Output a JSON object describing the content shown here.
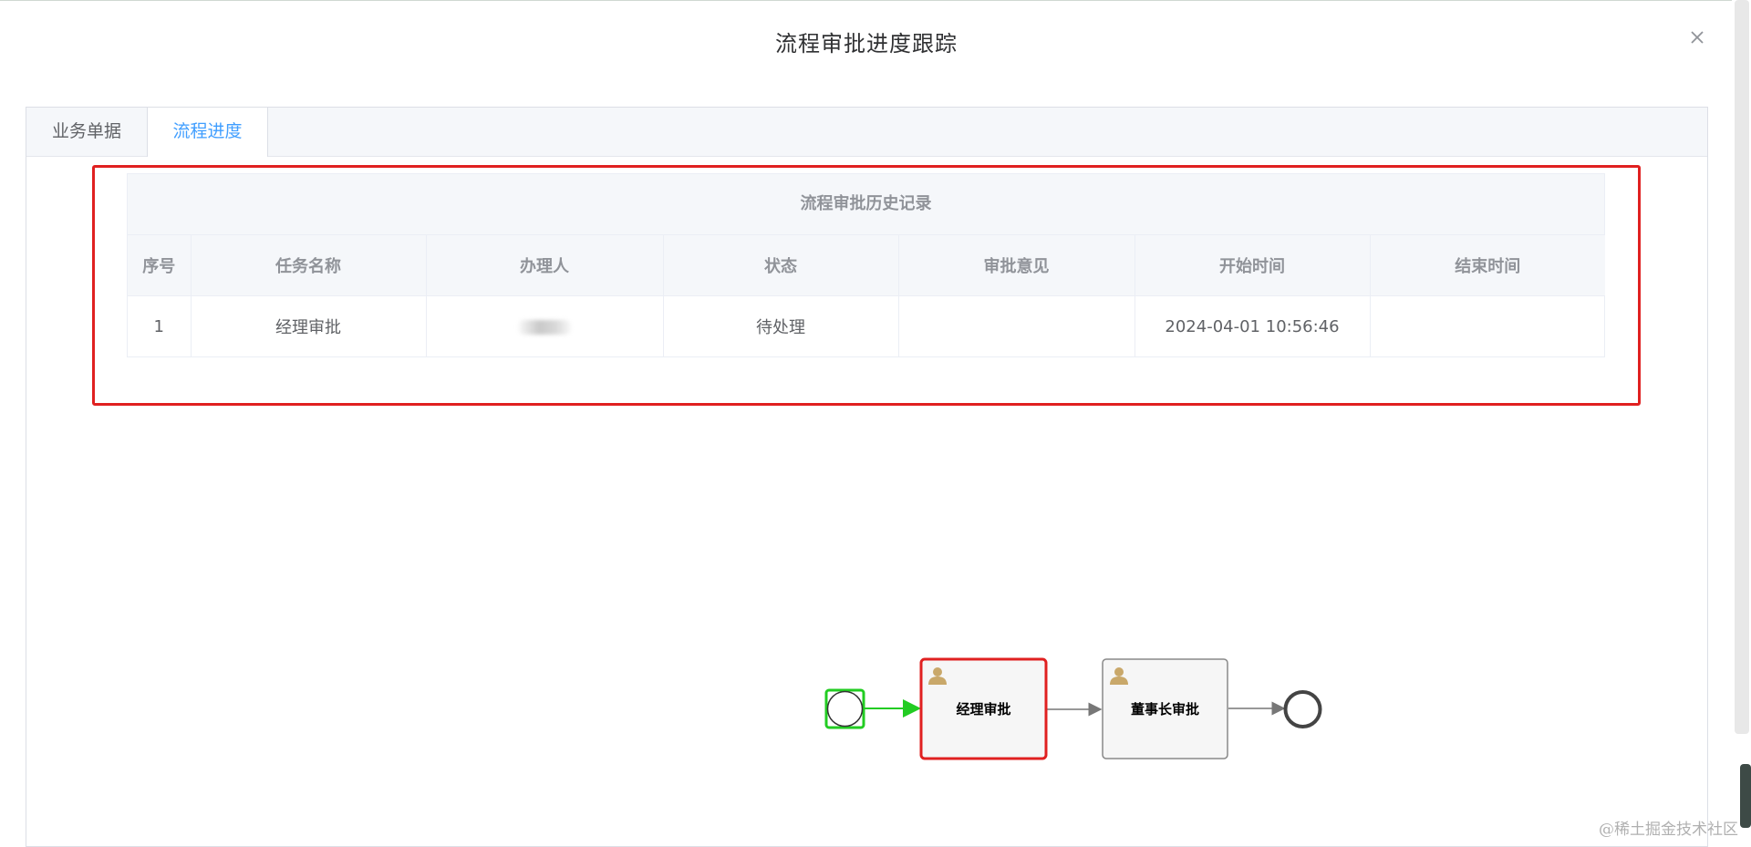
{
  "dialog": {
    "title": "流程审批进度跟踪"
  },
  "tabs": [
    {
      "label": "业务单据",
      "active": false
    },
    {
      "label": "流程进度",
      "active": true
    }
  ],
  "history": {
    "caption": "流程审批历史记录",
    "columns": [
      "序号",
      "任务名称",
      "办理人",
      "状态",
      "审批意见",
      "开始时间",
      "结束时间"
    ],
    "rows": [
      {
        "index": "1",
        "task": "经理审批",
        "assignee": "",
        "status": "待处理",
        "comment": "",
        "start": "2024-04-01 10:56:46",
        "end": ""
      }
    ]
  },
  "flow": {
    "nodes": [
      {
        "id": "start",
        "type": "start-event",
        "status": "completed"
      },
      {
        "id": "manager",
        "type": "user-task",
        "label": "经理审批",
        "status": "active"
      },
      {
        "id": "chairman",
        "type": "user-task",
        "label": "董事长审批",
        "status": "pending"
      },
      {
        "id": "end",
        "type": "end-event",
        "status": "pending"
      }
    ]
  },
  "colors": {
    "highlight": "#e02020",
    "active_tab": "#409eff",
    "completed": "#22cc22",
    "active_task": "#e02020"
  },
  "watermark": "@稀土掘金技术社区"
}
